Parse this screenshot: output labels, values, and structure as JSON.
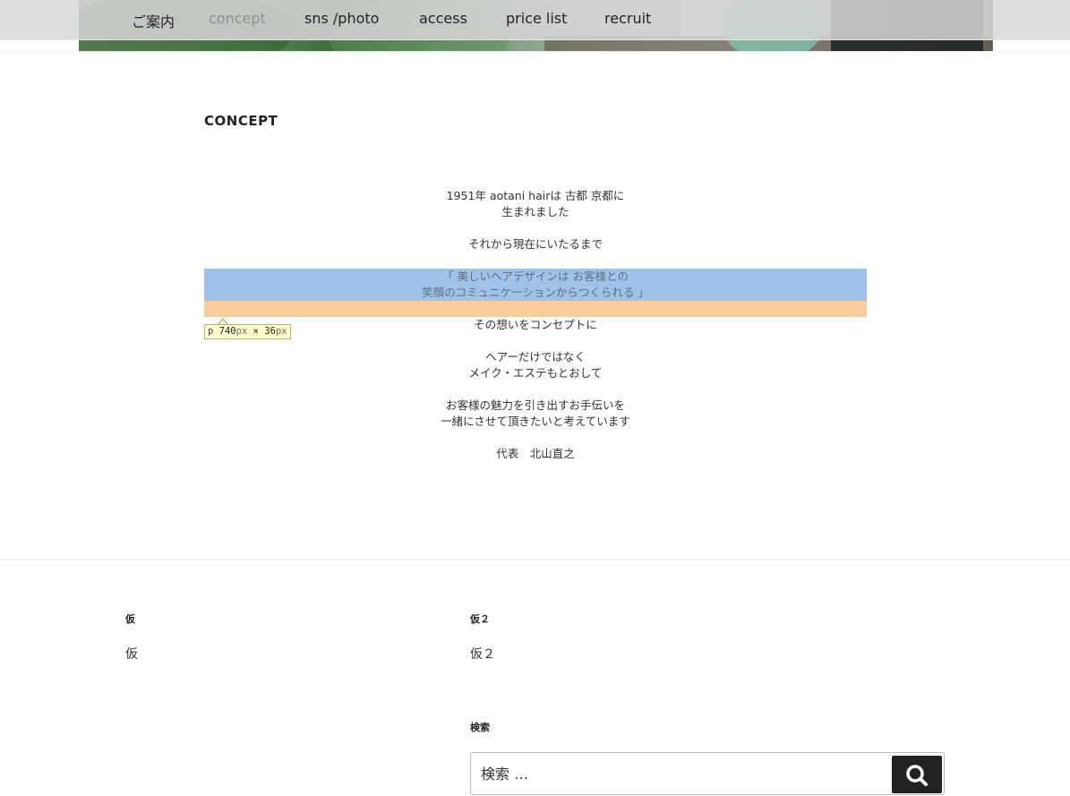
{
  "nav": {
    "items": [
      "ご案内",
      "concept",
      "sns /photo",
      "access",
      "price list",
      "recruit"
    ],
    "active_index": 1
  },
  "main": {
    "title": "CONCEPT",
    "paragraphs": [
      [
        "1951年 aotani hairは 古都 京都に",
        "生まれました"
      ],
      [
        "それから現在にいたるまで"
      ],
      [
        "「 美しいヘアデザインは お客様との",
        "笑顔のコミュニケーションからつくられる 」"
      ],
      [
        "その想いをコンセプトに"
      ],
      [
        "ヘアーだけではなく",
        "メイク・エステもとおして"
      ],
      [
        "お客様の魅力を引き出すお手伝いを",
        "一緒にさせて頂きたいと考えています"
      ],
      [
        "代表　北山直之"
      ]
    ]
  },
  "inspector": {
    "tag": "p",
    "width": "740",
    "height": "36",
    "unit": "px",
    "times": "×"
  },
  "footer": {
    "widget1": {
      "title": "仮",
      "text": "仮"
    },
    "widget2": {
      "title": "仮２",
      "text": "仮２"
    },
    "search": {
      "title": "検索",
      "placeholder": "検索 …",
      "button_icon": "search-icon"
    }
  },
  "colors": {
    "highlight_content": "#9fc3e8",
    "highlight_margin": "#f9cc9d",
    "nav_active": "#8f8f8f"
  }
}
